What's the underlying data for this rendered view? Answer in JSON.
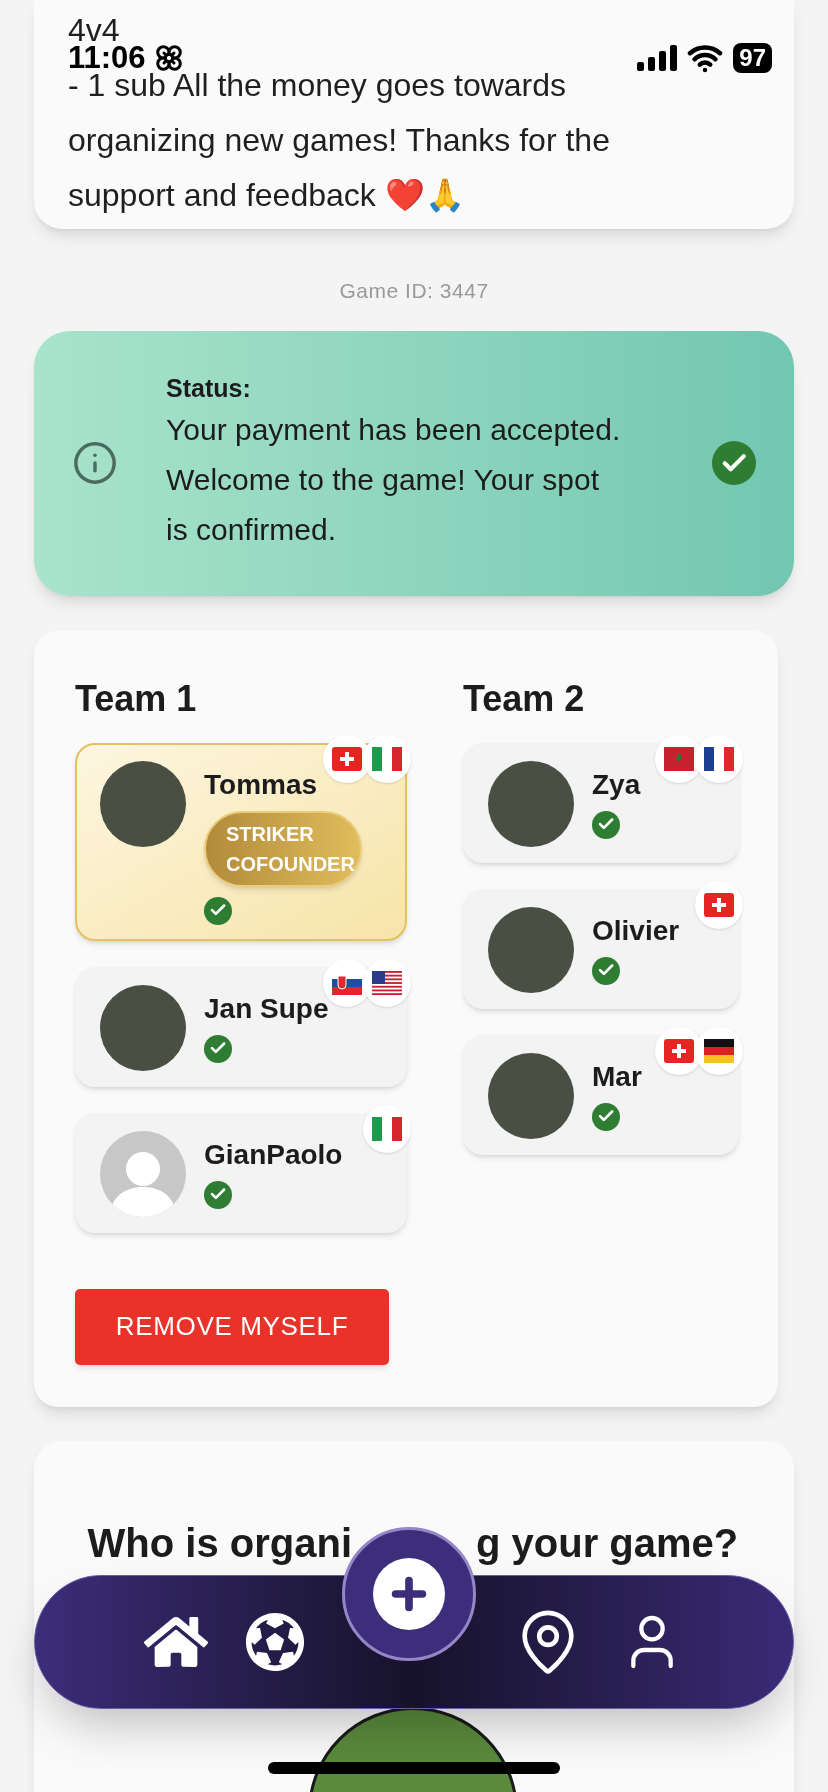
{
  "status_bar": {
    "time": "11:06",
    "battery": "97"
  },
  "description": {
    "lines": [
      "4v4",
      "- 1 sub All the money goes towards organizing new games! Thanks for the support and feedback ❤️🙏"
    ]
  },
  "game_id": "Game ID: 3447",
  "status_card": {
    "title": "Status:",
    "message": "Your payment has been accepted. Welcome to the game! Your spot is confirmed.",
    "confirmed": true
  },
  "teams": [
    {
      "name": "Team 1",
      "players": [
        {
          "name": "Tommas",
          "flags": [
            {
              "kind": "ch"
            },
            {
              "kind": "it"
            }
          ],
          "badge": "STRIKER COFOUNDER",
          "highlighted": true,
          "confirmed": true,
          "avatar": {
            "kind": "photo"
          }
        },
        {
          "name": "Jan Supe",
          "flags": [
            {
              "kind": "sk"
            },
            {
              "kind": "us"
            }
          ],
          "highlighted": false,
          "confirmed": true,
          "avatar": {
            "kind": "photo"
          }
        },
        {
          "name": "GianPaolo",
          "flags": [
            {
              "kind": "it"
            }
          ],
          "highlighted": false,
          "confirmed": true,
          "avatar": {
            "kind": "default"
          }
        }
      ]
    },
    {
      "name": "Team 2",
      "players": [
        {
          "name": "Zya",
          "flags": [
            {
              "kind": "ma"
            },
            {
              "kind": "fr"
            }
          ],
          "highlighted": false,
          "confirmed": true,
          "avatar": {
            "kind": "photo"
          }
        },
        {
          "name": "Olivier",
          "flags": [
            {
              "kind": "ch"
            }
          ],
          "highlighted": false,
          "confirmed": true,
          "avatar": {
            "kind": "photo"
          }
        },
        {
          "name": "Mar",
          "flags": [
            {
              "kind": "ch"
            },
            {
              "kind": "de"
            }
          ],
          "highlighted": false,
          "confirmed": true,
          "avatar": {
            "kind": "photo"
          }
        }
      ]
    }
  ],
  "remove_button": "REMOVE MYSELF",
  "organizer": {
    "heading_parts": [
      "Who is organi",
      "g your game?"
    ]
  },
  "nav": {
    "items": [
      {
        "kind": "home"
      },
      {
        "kind": "ball"
      },
      {
        "kind": "add"
      },
      {
        "kind": "location"
      },
      {
        "kind": "profile"
      }
    ]
  }
}
